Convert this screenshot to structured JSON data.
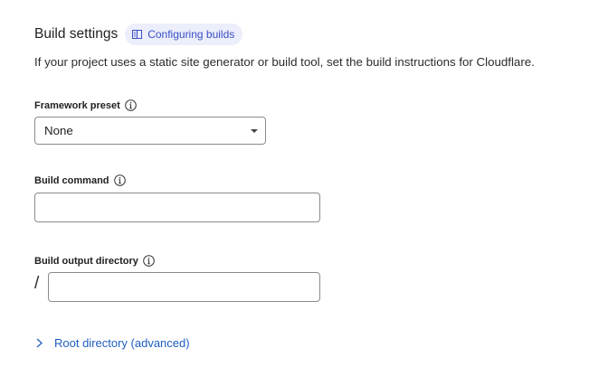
{
  "build_settings": {
    "title": "Build settings",
    "docs_link": "Configuring builds",
    "description": "If your project uses a static site generator or build tool, set the build instructions for Cloudflare."
  },
  "framework_preset": {
    "label": "Framework preset",
    "selected": "None"
  },
  "build_command": {
    "label": "Build command",
    "value": ""
  },
  "build_output": {
    "label": "Build output directory",
    "prefix": "/",
    "value": ""
  },
  "root_directory": {
    "label": "Root directory (advanced)"
  },
  "colors": {
    "accent": "#3b4fc6",
    "link": "#1f5fc0",
    "pill_bg": "#eceefb",
    "border": "#8a8a8a"
  },
  "icons": {
    "docs": "book-icon",
    "info": "info-icon",
    "dropdown": "caret-down-icon",
    "expand": "chevron-right-icon"
  }
}
